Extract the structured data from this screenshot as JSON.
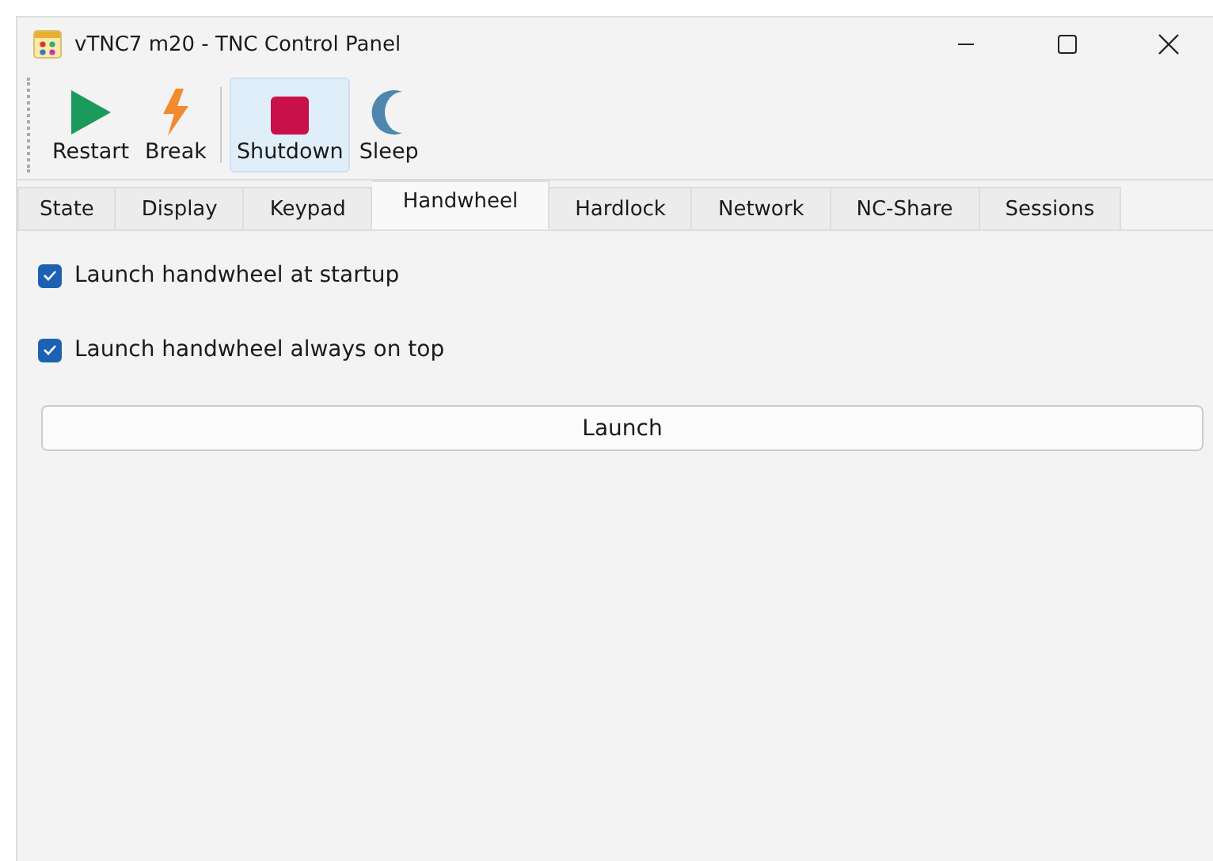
{
  "window": {
    "title": "vTNC7 m20 - TNC Control Panel"
  },
  "toolbar": [
    {
      "kind": "play",
      "label": "Restart",
      "selected": false
    },
    {
      "kind": "bolt",
      "label": "Break",
      "selected": false
    },
    {
      "kind": "stop",
      "label": "Shutdown",
      "selected": true
    },
    {
      "kind": "moon",
      "label": "Sleep",
      "selected": false
    }
  ],
  "tabs": [
    {
      "label": "State",
      "selected": false
    },
    {
      "label": "Display",
      "selected": false
    },
    {
      "label": "Keypad",
      "selected": false
    },
    {
      "label": "Handwheel",
      "selected": true
    },
    {
      "label": "Hardlock",
      "selected": false
    },
    {
      "label": "Network",
      "selected": false
    },
    {
      "label": "NC-Share",
      "selected": false
    },
    {
      "label": "Sessions",
      "selected": false
    }
  ],
  "options": [
    {
      "label": "Launch handwheel at startup",
      "checked": true
    },
    {
      "label": "Launch handwheel always on top",
      "checked": true
    }
  ],
  "launch_button": "Launch"
}
